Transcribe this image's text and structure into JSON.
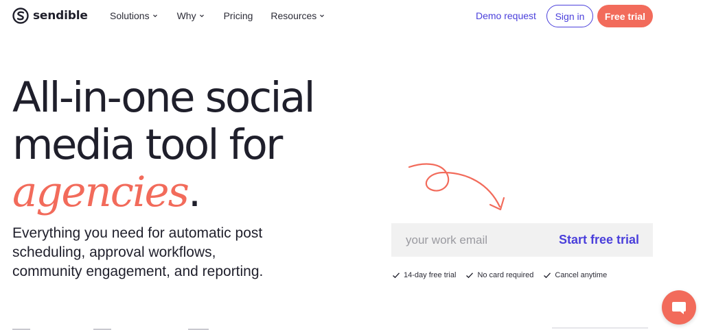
{
  "brand": {
    "name": "sendible",
    "accent": "#f26b5b",
    "primary": "#4a3fdb",
    "text": "#1f1f2b"
  },
  "nav": {
    "items": [
      {
        "label": "Solutions",
        "has_dropdown": true
      },
      {
        "label": "Why",
        "has_dropdown": true
      },
      {
        "label": "Pricing",
        "has_dropdown": false
      },
      {
        "label": "Resources",
        "has_dropdown": true
      }
    ],
    "demo_label": "Demo request",
    "signin_label": "Sign in",
    "trial_label": "Free trial"
  },
  "hero": {
    "line1": "All-in-one social",
    "line2": "media tool for",
    "accent_word": "agencies",
    "period": ".",
    "subtitle": "Everything you need for automatic post scheduling, approval workflows, community engagement, and reporting."
  },
  "signup": {
    "email_placeholder": "your work email",
    "email_value": "",
    "start_label": "Start free trial",
    "checks": [
      "14-day free trial",
      "No card required",
      "Cancel anytime"
    ]
  },
  "icons": {
    "logo": "sendible-logo-icon",
    "chevron": "chevron-down-icon",
    "check": "check-icon",
    "arrow": "curly-arrow-icon",
    "chat": "chat-bubble-icon"
  }
}
